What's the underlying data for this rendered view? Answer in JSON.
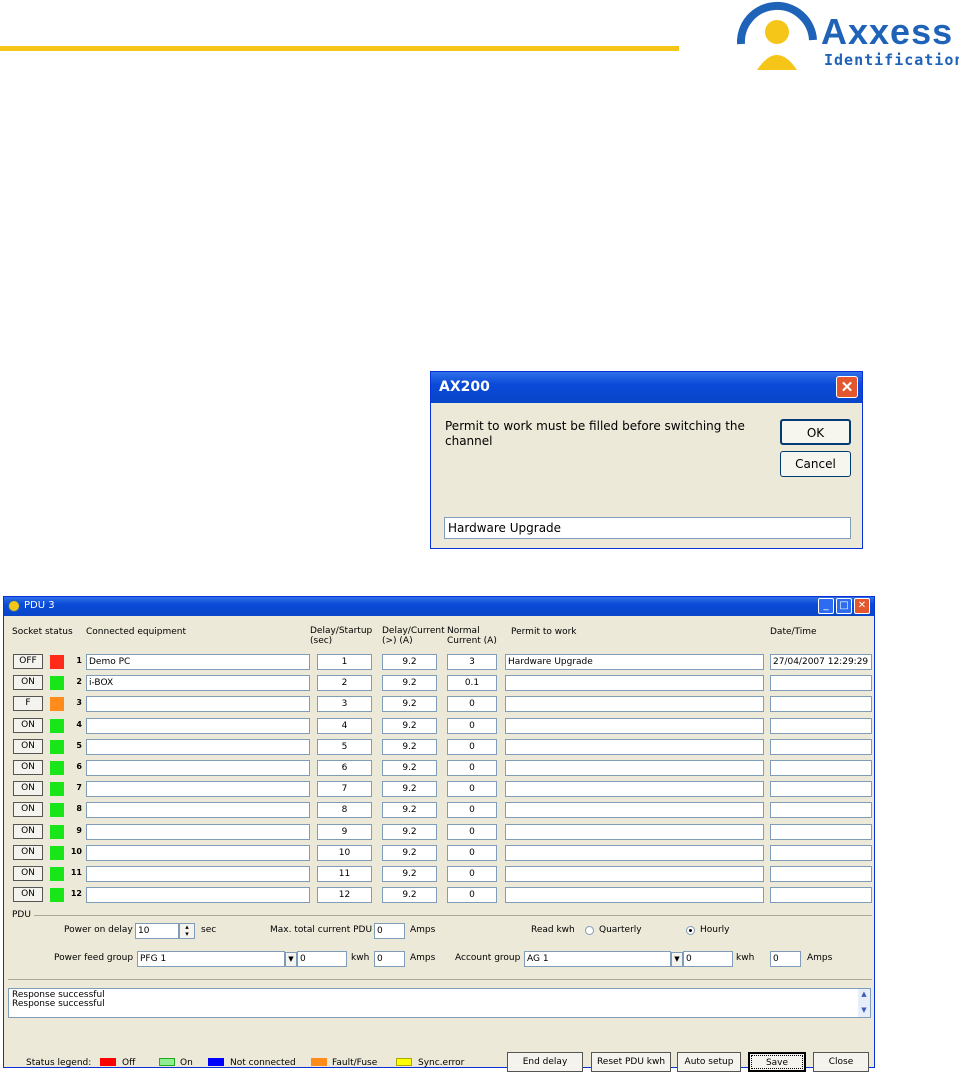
{
  "branding": {
    "logo_word": "Axxess",
    "logo_sub": "Identification"
  },
  "dialog": {
    "title": "AX200",
    "close_glyph": "✕",
    "message": "Permit to work must be filled before switching the channel",
    "ok_label": "OK",
    "cancel_label": "Cancel",
    "input_value": "Hardware Upgrade"
  },
  "pdu_window": {
    "title": "PDU 3",
    "headers": {
      "socket_status": "Socket status",
      "connected_equipment": "Connected equipment",
      "delay_startup": "Delay/Startup (sec)",
      "delay_current": "Delay/Current (>) (A)",
      "normal_current": "Normal Current (A)",
      "permit": "Permit to work",
      "datetime": "Date/Time"
    },
    "rows": [
      {
        "btn": "OFF",
        "num": "1",
        "equipment": "Demo PC",
        "delay": "1",
        "dcur": "9.2",
        "ncur": "3",
        "permit": "Hardware Upgrade",
        "datetime": "27/04/2007 12:29:29",
        "status": "off"
      },
      {
        "btn": "ON",
        "num": "2",
        "equipment": "i-BOX",
        "delay": "2",
        "dcur": "9.2",
        "ncur": "0.1",
        "permit": "",
        "datetime": "",
        "status": "on"
      },
      {
        "btn": "F",
        "num": "3",
        "equipment": "",
        "delay": "3",
        "dcur": "9.2",
        "ncur": "0",
        "permit": "",
        "datetime": "",
        "status": "fault"
      },
      {
        "btn": "ON",
        "num": "4",
        "equipment": "",
        "delay": "4",
        "dcur": "9.2",
        "ncur": "0",
        "permit": "",
        "datetime": "",
        "status": "on"
      },
      {
        "btn": "ON",
        "num": "5",
        "equipment": "",
        "delay": "5",
        "dcur": "9.2",
        "ncur": "0",
        "permit": "",
        "datetime": "",
        "status": "on"
      },
      {
        "btn": "ON",
        "num": "6",
        "equipment": "",
        "delay": "6",
        "dcur": "9.2",
        "ncur": "0",
        "permit": "",
        "datetime": "",
        "status": "on"
      },
      {
        "btn": "ON",
        "num": "7",
        "equipment": "",
        "delay": "7",
        "dcur": "9.2",
        "ncur": "0",
        "permit": "",
        "datetime": "",
        "status": "on"
      },
      {
        "btn": "ON",
        "num": "8",
        "equipment": "",
        "delay": "8",
        "dcur": "9.2",
        "ncur": "0",
        "permit": "",
        "datetime": "",
        "status": "on"
      },
      {
        "btn": "ON",
        "num": "9",
        "equipment": "",
        "delay": "9",
        "dcur": "9.2",
        "ncur": "0",
        "permit": "",
        "datetime": "",
        "status": "on"
      },
      {
        "btn": "ON",
        "num": "10",
        "equipment": "",
        "delay": "10",
        "dcur": "9.2",
        "ncur": "0",
        "permit": "",
        "datetime": "",
        "status": "on"
      },
      {
        "btn": "ON",
        "num": "11",
        "equipment": "",
        "delay": "11",
        "dcur": "9.2",
        "ncur": "0",
        "permit": "",
        "datetime": "",
        "status": "on"
      },
      {
        "btn": "ON",
        "num": "12",
        "equipment": "",
        "delay": "12",
        "dcur": "9.2",
        "ncur": "0",
        "permit": "",
        "datetime": "",
        "status": "on"
      }
    ],
    "pdu": {
      "group_label": "PDU",
      "power_on_delay_label": "Power on delay",
      "power_on_delay_value": "10",
      "sec_label": "sec",
      "max_current_label": "Max. total current PDU",
      "max_current_value": "0",
      "amps_label": "Amps",
      "read_kwh_label": "Read kwh",
      "quarterly_label": "Quarterly",
      "hourly_label": "Hourly",
      "read_kwh_selected": "Hourly",
      "power_feed_group_label": "Power feed group",
      "power_feed_group_value": "PFG 1",
      "pfg_kwh_value": "0",
      "kwh_label": "kwh",
      "pfg_amps_value": "0",
      "account_group_label": "Account group",
      "account_group_value": "AG 1",
      "ag_kwh_value": "0",
      "ag_amps_value": "0"
    },
    "log_lines": [
      "Response successful",
      "Response successful"
    ],
    "legend": {
      "label": "Status legend:",
      "items": [
        {
          "label": "Off",
          "color": "#ff0000"
        },
        {
          "label": "On",
          "color": "#90ee90"
        },
        {
          "label": "Not connected",
          "color": "#0000ff"
        },
        {
          "label": "Fault/Fuse",
          "color": "#ff8c1a"
        },
        {
          "label": "Sync.error",
          "color": "#ffff00"
        }
      ]
    },
    "buttons": {
      "end_delay": "End delay",
      "reset_kwh": "Reset PDU kwh",
      "auto_setup": "Auto setup",
      "save": "Save",
      "close": "Close"
    },
    "status_colors": {
      "off": "#ff2a1a",
      "on": "#19e619",
      "fault": "#ff8c1a"
    }
  }
}
